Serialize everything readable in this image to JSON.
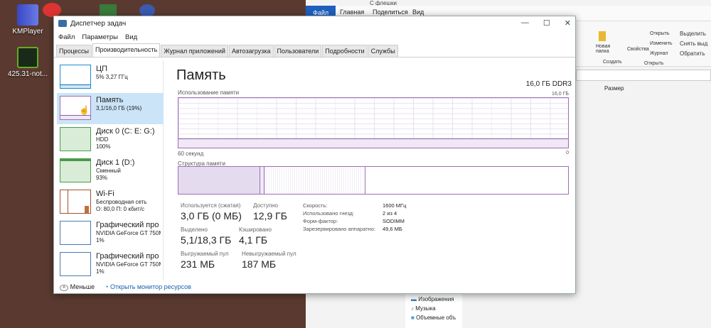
{
  "desktop": {
    "icons": [
      {
        "label": "KMPlayer"
      },
      {
        "label": "425.31-not..."
      }
    ]
  },
  "explorer": {
    "title": "С флешки",
    "tabs": [
      "Файл",
      "Главная",
      "Поделиться",
      "Вид"
    ],
    "ribbon": {
      "new_folder": "Новая папка",
      "create": "Создать",
      "properties": "Свойства",
      "open": "Открыть",
      "edit": "Изменить",
      "history": "Журнал",
      "open_group": "Открыть",
      "select_all": "Выделить",
      "deselect": "Снять выд",
      "invert": "Обратить"
    },
    "column_size": "Размер",
    "nav": [
      "Изображения",
      "Музыка",
      "Объемные объ"
    ]
  },
  "tm": {
    "title": "Диспетчер задач",
    "menu": [
      "Файл",
      "Параметры",
      "Вид"
    ],
    "tabs": [
      "Процессы",
      "Производительность",
      "Журнал приложений",
      "Автозагрузка",
      "Пользователи",
      "Подробности",
      "Службы"
    ],
    "sidebar": [
      {
        "name": "ЦП",
        "l1": "5% 3,27 ГГц",
        "l2": ""
      },
      {
        "name": "Память",
        "l1": "3,1/16,0 ГБ (19%)",
        "l2": ""
      },
      {
        "name": "Диск 0 (C: E: G:)",
        "l1": "HDD",
        "l2": "100%"
      },
      {
        "name": "Диск 1 (D:)",
        "l1": "Сменный",
        "l2": "93%"
      },
      {
        "name": "Wi-Fi",
        "l1": "Беспроводная сеть",
        "l2": "О: 80,0 П: 0 кбит/с"
      },
      {
        "name": "Графический про",
        "l1": "NVIDIA GeForce GT 750M",
        "l2": "1%"
      },
      {
        "name": "Графический про",
        "l1": "NVIDIA GeForce GT 750M",
        "l2": "1%"
      }
    ],
    "footer": {
      "less": "Меньше",
      "monitor": "Открыть монитор ресурсов"
    },
    "main": {
      "title": "Память",
      "spec": "16,0 ГБ DDR3",
      "usage_label": "Использование памяти",
      "usage_max": "16,0 ГБ",
      "time_label": "60 секунд",
      "zero": "0",
      "usage_percent": 19,
      "struct_label": "Структура памяти",
      "stats": [
        {
          "label": "Используется (сжатая)",
          "value": "3,0 ГБ (0 МБ)"
        },
        {
          "label": "Доступно",
          "value": "12,9 ГБ"
        },
        {
          "label": "Выделено",
          "value": "5,1/18,3 ГБ"
        },
        {
          "label": "Кэшировано",
          "value": "4,1 ГБ"
        },
        {
          "label": "Выгружаемый пул",
          "value": "231 МБ"
        },
        {
          "label": "Невыгружаемый пул",
          "value": "187 МБ"
        }
      ],
      "specs": [
        {
          "label": "Скорость:",
          "value": "1600 МГц"
        },
        {
          "label": "Использовано гнезд:",
          "value": "2 из 4"
        },
        {
          "label": "Форм-фактор:",
          "value": "SODIMM"
        },
        {
          "label": "Зарезервировано аппаратно:",
          "value": "49,6 МБ"
        }
      ]
    }
  }
}
